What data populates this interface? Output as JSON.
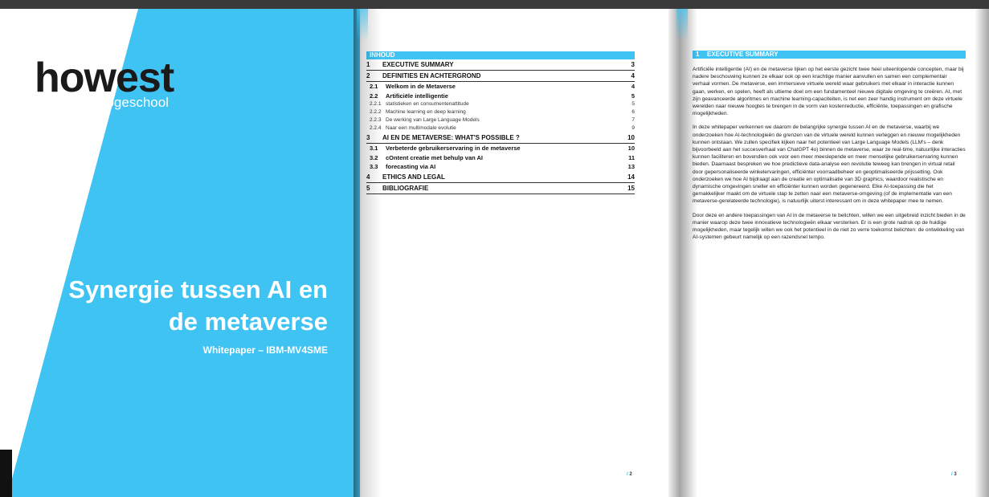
{
  "cover": {
    "logo_text": "howest",
    "logo_sub": "hogeschool",
    "title": "Synergie tussen AI en de metaverse",
    "subtitle": "Whitepaper – IBM-MV4SME"
  },
  "toc": {
    "heading": "INHOUD",
    "entries": [
      {
        "num": "1",
        "label": "EXECUTIVE SUMMARY",
        "page": "3"
      },
      {
        "num": "2",
        "label": "DEFINITIES EN ACHTERGROND",
        "page": "4"
      },
      {
        "num": "2.1",
        "label": "Welkom in de Metaverse",
        "page": "4"
      },
      {
        "num": "2.2",
        "label": "Artificiële intelligentie",
        "page": "5"
      },
      {
        "num": "2.2.1",
        "label": "statistieken en consumentenattitude",
        "page": "5"
      },
      {
        "num": "2.2.2",
        "label": "Machine learning en deep learning",
        "page": "6"
      },
      {
        "num": "2.2.3",
        "label": "De werking van Large Language Models",
        "page": "7"
      },
      {
        "num": "2.2.4",
        "label": "Naar een multimodale evolutie",
        "page": "9"
      },
      {
        "num": "3",
        "label": "AI EN DE METAVERSE: WHAT'S POSSIBLE ?",
        "page": "10"
      },
      {
        "num": "3.1",
        "label": "Verbeterde gebruikerservaring in de metaverse",
        "page": "10"
      },
      {
        "num": "3.2",
        "label": "cOntent creatie met behulp van AI",
        "page": "11"
      },
      {
        "num": "3.3",
        "label": "forecasting via AI",
        "page": "13"
      },
      {
        "num": "4",
        "label": "ETHICS AND LEGAL",
        "page": "14"
      },
      {
        "num": "5",
        "label": "BIBLIOGRAFIE",
        "page": "15"
      }
    ],
    "page_number": "2"
  },
  "summary": {
    "num": "1",
    "heading": "EXECUTIVE SUMMARY",
    "paragraphs": [
      "Artificiële intelligentie (AI) en de metaverse lijken op het eerste gezicht twee heel uiteenlopende concepten, maar bij nadere beschouwing kunnen ze elkaar ook op een krachtige manier aanvullen en samen een complementair verhaal vormen. De metaverse, een immersieve virtuele wereld waar gebruikers met elkaar in interactie kunnen gaan, werken, en spelen, heeft als ultieme doel om een fundamenteel nieuwe digitale omgeving te creëren. AI, met zijn geavanceerde algoritmes en machine learning-capaciteiten, is net een zeer handig instrument om deze virtuele werelden naar nieuwe hoogtes te brengen in de vorm van kostenreductie, efficiënte, toepassingen en grafische mogelijkheden.",
      "In deze whitepaper verkennen we daarom de belangrijke synergie tussen AI en de metaverse, waarbij we onderzoeken hoe AI-technologieën de grenzen van de virtuele wereld kunnen verleggen en nieuwe mogelijkheden kunnen ontstaan. We zullen specifiek kijken naar het potentieel van Large Language Models (LLM's – denk bijvoorbeeld aan het succesverhaal van ChatGPT 4o) binnen de metaverse, waar ze real-time, natuurlijke interacties kunnen faciliteren en bovendien ook voor een meer meeslepende en meer menselijke gebruikerservaring kunnen bieden. Daarnaast bespreken we hoe predictieve data-analyse een revolutie teweeg kan brengen in virtual retail door gepersonaliseerde winkelervaringen, efficiënter voorraadbeheer en geoptimaliseerde prijssetting. Ook onderzoeken we hoe AI bijdraagt aan de creatie en optimalisatie van 3D graphics, waardoor realistische en dynamische omgevingen sneller en efficiënter kunnen worden gegenereerd. Elke AI-toepassing die het gemakkelijker maakt om de virtuele stap te zetten naar een metaverse-omgeving (of de implementatie van een metaverse-gerelateerde technologie), is natuurlijk uiterst interessant om in deze whitepaper mee te nemen.",
      "Door deze en andere toepassingen van AI in de metaverse te belichten, willen we een uitgebreid inzicht bieden in de manier waarop deze twee innovatieve technologieën elkaar versterken. Er is een grote nadruk op de huidige mogelijkheden, maar tegelijk willen we ook het potentieel in de niet zo verre toekomst belichten: de ontwikkeling van AI-systemen gebeurt namelijk op een razendsnel tempo."
    ],
    "page_number": "3"
  }
}
